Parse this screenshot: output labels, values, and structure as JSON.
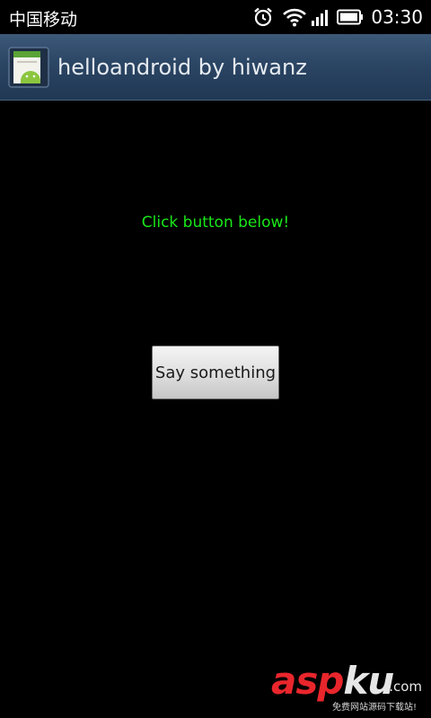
{
  "status_bar": {
    "carrier": "中国移动",
    "time": "03:30",
    "icons": [
      "alarm-icon",
      "wifi-icon",
      "signal-icon",
      "battery-icon"
    ]
  },
  "title_bar": {
    "title": "helloandroid by hiwanz",
    "icon": "android-app-icon",
    "background_color": "#2b4564"
  },
  "main": {
    "hint_text": "Click button below!",
    "hint_color": "#19e819",
    "button_label": "Say something"
  },
  "watermark": {
    "logo_part1": "asp",
    "logo_part2": "ku",
    "domain": ".com",
    "tagline": "免费网站源码下载站!"
  }
}
